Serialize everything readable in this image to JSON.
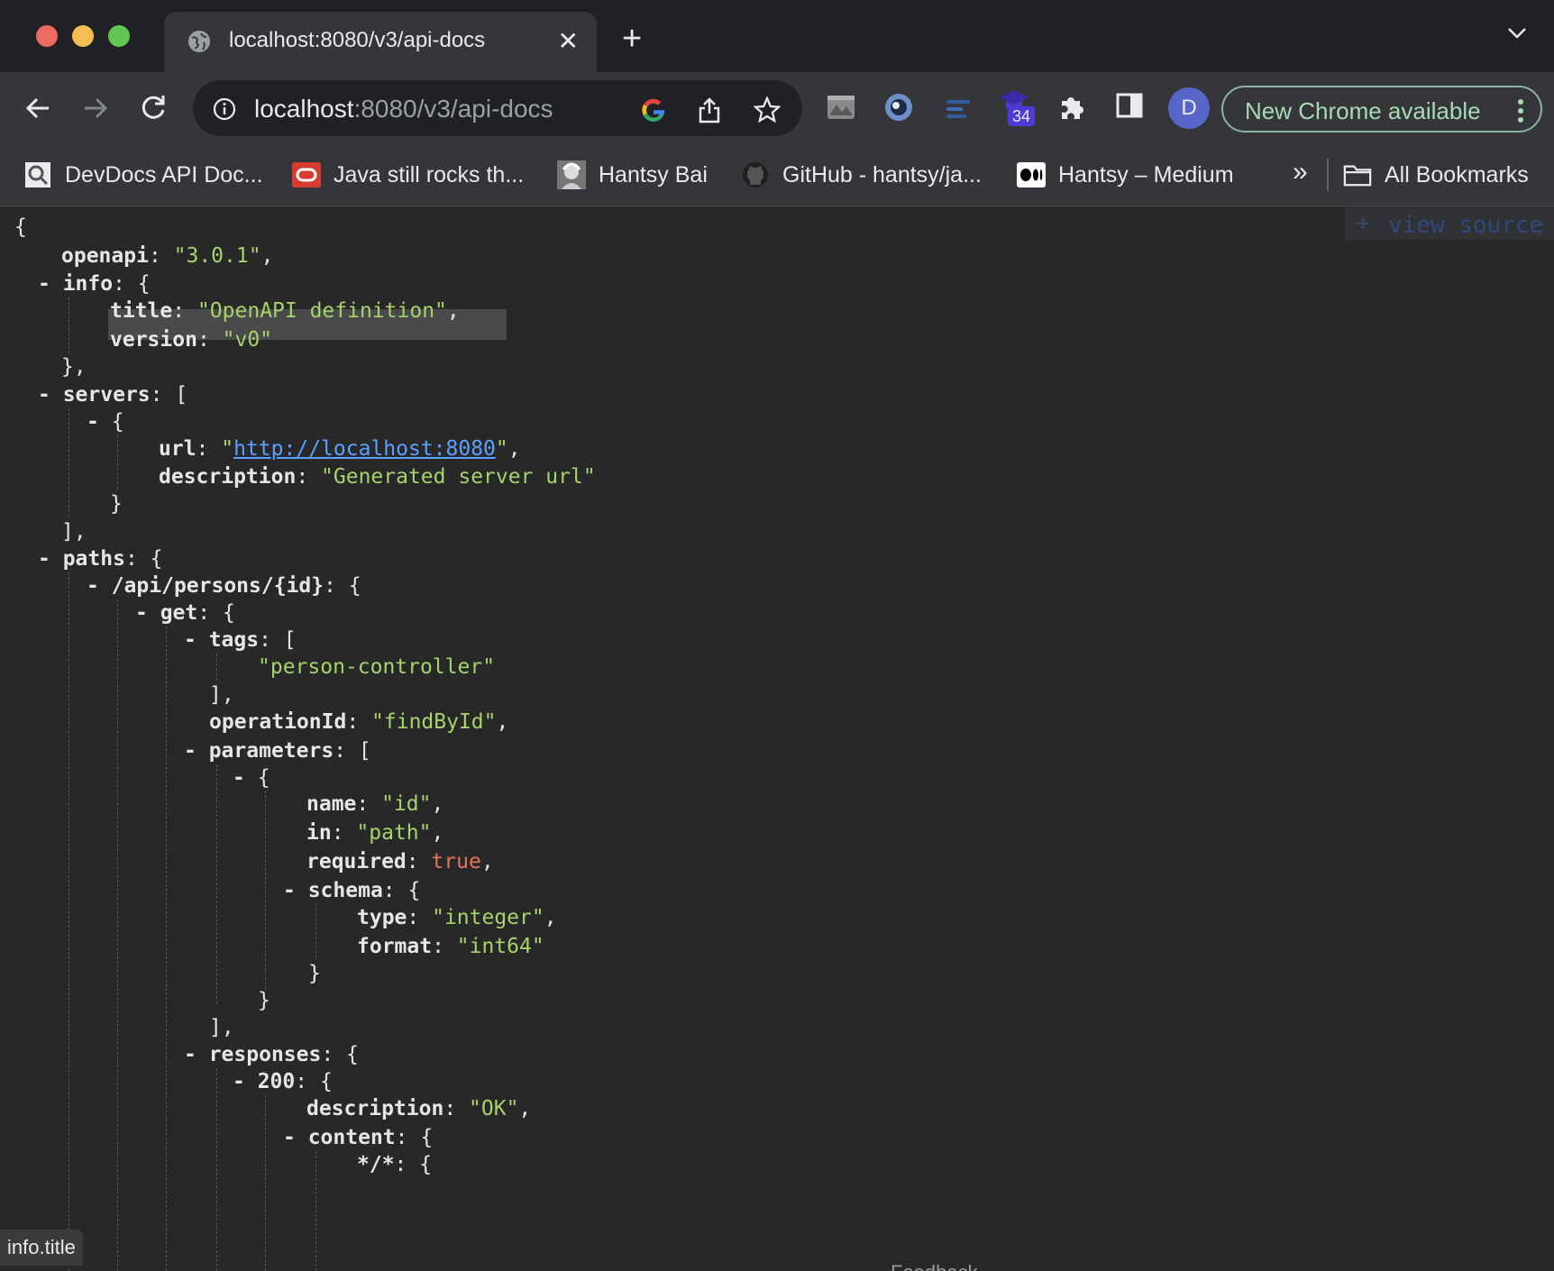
{
  "tab": {
    "title": "localhost:8080/v3/api-docs",
    "close": "✕"
  },
  "omnibox": {
    "host": "localhost",
    "rest": ":8080/v3/api-docs"
  },
  "extensions": {
    "badge": "34"
  },
  "profile": {
    "initial": "D"
  },
  "update": {
    "label": "New Chrome available"
  },
  "bookmarks": {
    "items": [
      {
        "label": "DevDocs API Doc..."
      },
      {
        "label": "Java still rocks th..."
      },
      {
        "label": "Hantsy Bai"
      },
      {
        "label": "GitHub - hantsy/ja..."
      },
      {
        "label": "Hantsy – Medium"
      }
    ],
    "overflow": "»",
    "all": "All Bookmarks"
  },
  "viewer": {
    "view_source": "view source",
    "plus": "+",
    "minus": "-"
  },
  "json": {
    "open_brace": "{",
    "openapi_key": "openapi",
    "openapi_val": "\"3.0.1\"",
    "info_key": "info",
    "title_key": "title",
    "title_val": "\"OpenAPI definition\"",
    "version_key": "version",
    "version_val": "\"v0\"",
    "servers_key": "servers",
    "url_key": "url",
    "url_val": "http://localhost:8080",
    "description_key": "description",
    "server_desc_val": "\"Generated server url\"",
    "paths_key": "paths",
    "path_key": "/api/persons/{id}",
    "get_key": "get",
    "tags_key": "tags",
    "tag_val": "\"person-controller\"",
    "operationId_key": "operationId",
    "operationId_val": "\"findById\"",
    "parameters_key": "parameters",
    "name_key": "name",
    "name_val": "\"id\"",
    "in_key": "in",
    "in_val": "\"path\"",
    "required_key": "required",
    "required_val": "true",
    "schema_key": "schema",
    "type_key": "type",
    "type_val": "\"integer\"",
    "format_key": "format",
    "format_val": "\"int64\"",
    "responses_key": "responses",
    "code_key": "200",
    "ok_val": "\"OK\"",
    "content_key": "content",
    "media_key": "*/*"
  },
  "status": {
    "text": "info.title"
  },
  "feedback": "Feedback"
}
